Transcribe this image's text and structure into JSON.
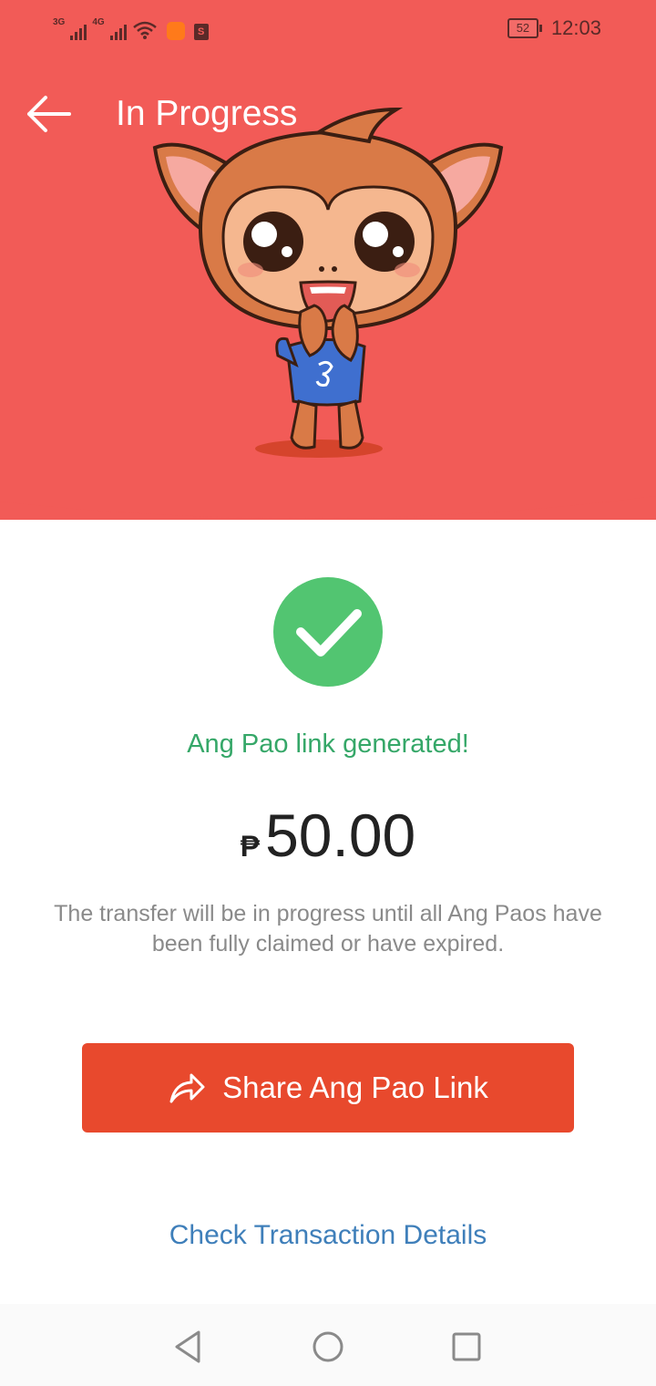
{
  "status_bar": {
    "network_1": "3G",
    "network_2": "4G",
    "battery": "52",
    "time": "12:03"
  },
  "app_bar": {
    "back_icon": "arrow-left-icon",
    "title": "In Progress"
  },
  "hero": {
    "background_color": "#f25b57",
    "mascot": "monkey-mascot-illustration"
  },
  "result": {
    "status_icon": "check-circle-icon",
    "message": "Ang Pao link generated!",
    "currency_symbol": "₱",
    "amount": "50.00",
    "info": "The transfer will be in progress until all Ang Paos have been fully claimed or have expired."
  },
  "actions": {
    "share_label": "Share Ang Pao Link",
    "share_icon": "share-arrow-icon",
    "details_label": "Check Transaction Details"
  },
  "nav_bar": {
    "back": "triangle-back-icon",
    "home": "circle-home-icon",
    "recents": "square-recents-icon"
  },
  "colors": {
    "accent": "#e8492d",
    "success": "#35a768",
    "link": "#3f7fba"
  }
}
